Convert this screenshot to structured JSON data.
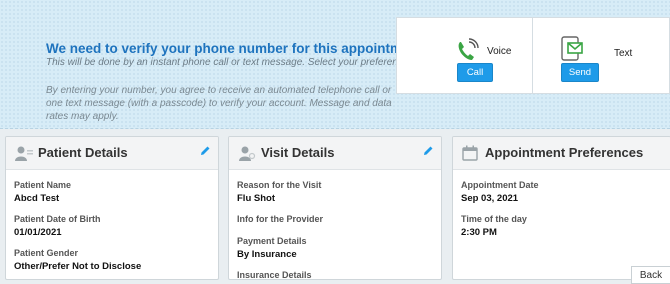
{
  "verification": {
    "title": "We need to verify your phone number for this appointment",
    "subtitle": "This will be done by an instant phone call or text message. Select your preference.",
    "consent": "By entering your number, you agree to receive an automated telephone call or one text message (with a passcode) to verify your account. Message and data rates may apply."
  },
  "methods": {
    "voice": {
      "label": "Voice",
      "button": "Call",
      "icon": "phone-icon"
    },
    "text": {
      "label": "Text",
      "button": "Send",
      "icon": "message-icon"
    }
  },
  "patient": {
    "title": "Patient Details",
    "name_label": "Patient Name",
    "name": "Abcd Test",
    "dob_label": "Patient Date of Birth",
    "dob": "01/01/2021",
    "gender_label": "Patient Gender",
    "gender": "Other/Prefer Not to Disclose"
  },
  "visit": {
    "title": "Visit Details",
    "reason_label": "Reason for the Visit",
    "reason": "Flu Shot",
    "info_label": "Info for the Provider",
    "payment_label": "Payment Details",
    "payment": "By Insurance",
    "insurance_label": "Insurance Details"
  },
  "preferences": {
    "title": "Appointment Preferences",
    "date_label": "Appointment Date",
    "date": "Sep 03, 2021",
    "time_label": "Time of the day",
    "time": "2:30 PM"
  },
  "back_label": "Back",
  "colors": {
    "accent": "#1e9be9",
    "title_blue": "#1e73be",
    "banner": "#d7ecf7"
  }
}
